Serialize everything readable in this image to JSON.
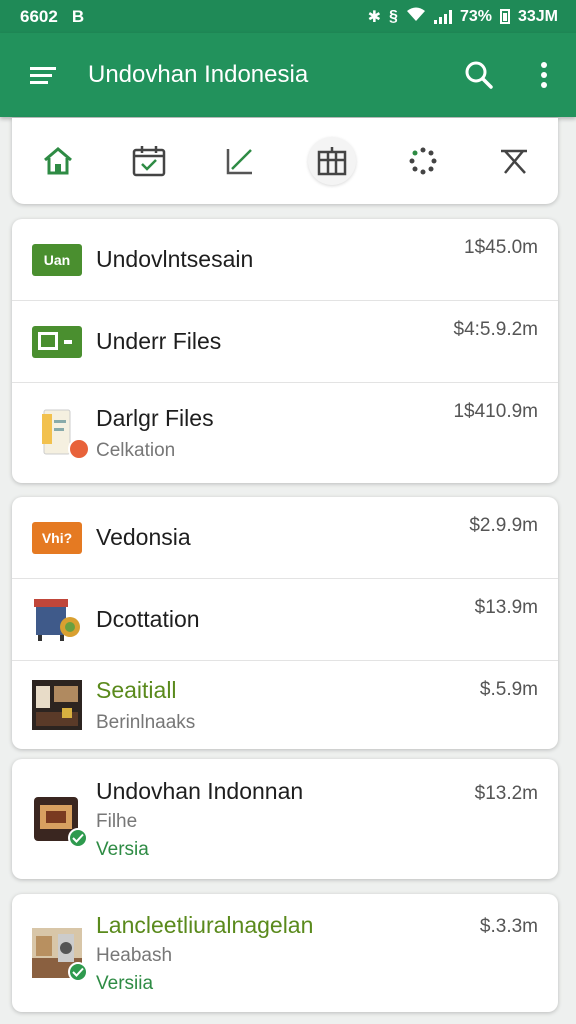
{
  "status": {
    "left": "6602",
    "carrier": "B",
    "battery": "73%",
    "time": "33JM"
  },
  "appbar": {
    "title": "Undovhan Indonesia"
  },
  "toolbar": {
    "items": [
      "home",
      "calendar-check",
      "edit",
      "store",
      "loading",
      "tools"
    ]
  },
  "group1": [
    {
      "tag": "Uan",
      "tag_color": "#4a8f2f",
      "name": "Undovlntsesain",
      "price": "1$45.0m"
    },
    {
      "name": "Underr Files",
      "price": "$4:5.9.2m"
    },
    {
      "name": "Darlgr Files",
      "sub": "Celkation",
      "price": "1$410.9m"
    }
  ],
  "group2": [
    {
      "tag": "Vhi?",
      "tag_color": "#e57a22",
      "name": "Vedonsia",
      "price": "$2.9.9m"
    },
    {
      "name": "Dcottation",
      "price": "$13.9m"
    },
    {
      "name": "Seaitiall",
      "sub": "Berinlnaaks",
      "price": "$.5.9m"
    }
  ],
  "group3": [
    {
      "name": "Undovhan Indonnan",
      "sub": "Filhe",
      "sub2": "Versia",
      "price": "$13.2m"
    }
  ],
  "group4": [
    {
      "name": "Lancleetliuralnagelan",
      "sub": "Heabash",
      "sub2": "Versiia",
      "price": "$.3.3m"
    }
  ],
  "colors": {
    "appbar": "#22925c",
    "statusbar": "#1f8a57",
    "accent_green": "#2e9a4e"
  }
}
